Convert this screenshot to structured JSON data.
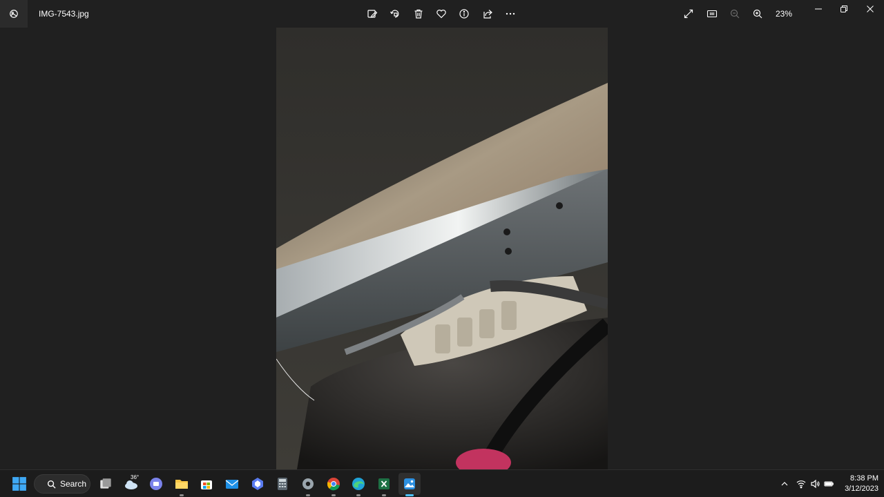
{
  "window": {
    "filename": "IMG-7543.jpg",
    "zoom_level": "23%",
    "toolbar_icons": [
      "edit-image-icon",
      "rotate-icon",
      "delete-icon",
      "favorite-icon",
      "info-icon",
      "share-icon",
      "more-icon"
    ],
    "view_icons": [
      "fullscreen-icon",
      "actual-size-icon",
      "zoom-out-icon",
      "zoom-in-icon"
    ],
    "window_controls": [
      "minimize-icon",
      "restore-icon",
      "close-icon"
    ]
  },
  "photo": {
    "subject": "vehicle underside photo"
  },
  "taskbar": {
    "search_label": "Search",
    "weather_temp": "36°",
    "apps": [
      "start",
      "search",
      "task-view",
      "weather",
      "teams-chat",
      "file-explorer",
      "microsoft-store",
      "mail",
      "copilot",
      "calculator",
      "settings",
      "chrome",
      "edge",
      "excel",
      "photos"
    ],
    "clock_time": "8:38 PM",
    "clock_date": "3/12/2023"
  },
  "colors": {
    "background": "#202020",
    "taskbar": "#1c1c1c",
    "accent": "#4cc2ff"
  }
}
